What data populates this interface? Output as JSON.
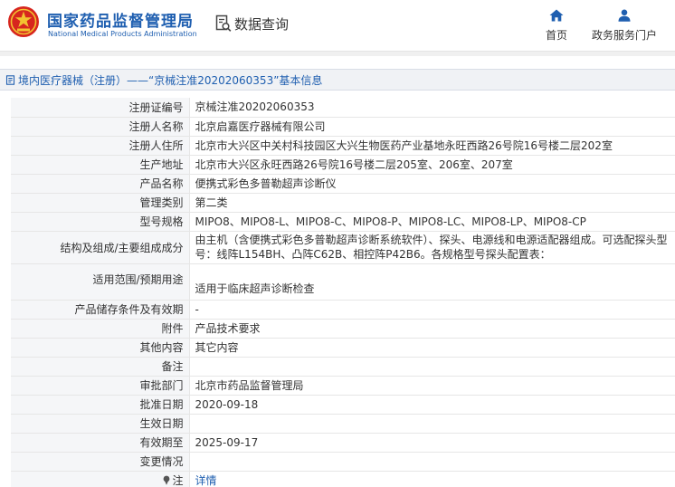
{
  "header": {
    "brand_cn": "国家药品监督管理局",
    "brand_en": "National Medical Products Administration",
    "query_label": "数据查询",
    "nav": [
      {
        "label": "首页",
        "icon": "home-icon"
      },
      {
        "label": "政务服务门户",
        "icon": "user-icon"
      }
    ]
  },
  "breadcrumb": {
    "text": "境内医疗器械（注册）——“京械注准20202060353”基本信息"
  },
  "rows": [
    {
      "label": "注册证编号",
      "value": "京械注准20202060353"
    },
    {
      "label": "注册人名称",
      "value": "北京启嘉医疗器械有限公司"
    },
    {
      "label": "注册人住所",
      "value": "北京市大兴区中关村科技园区大兴生物医药产业基地永旺西路26号院16号楼二层202室"
    },
    {
      "label": "生产地址",
      "value": "北京市大兴区永旺西路26号院16号楼二层205室、206室、207室"
    },
    {
      "label": "产品名称",
      "value": "便携式彩色多普勒超声诊断仪"
    },
    {
      "label": "管理类别",
      "value": "第二类"
    },
    {
      "label": "型号规格",
      "value": "MIPO8、MIPO8-L、MIPO8-C、MIPO8-P、MIPO8-LC、MIPO8-LP、MIPO8-CP"
    },
    {
      "label": "结构及组成/主要组成成分",
      "value": "由主机（含便携式彩色多普勒超声诊断系统软件）、探头、电源线和电源适配器组成。可选配探头型号：线阵L154BH、凸阵C62B、相控阵P42B6。各规格型号探头配置表："
    },
    {
      "label": "适用范围/预期用途",
      "value": "适用于临床超声诊断检查"
    },
    {
      "label": "产品储存条件及有效期",
      "value": "-"
    },
    {
      "label": "附件",
      "value": "产品技术要求"
    },
    {
      "label": "其他内容",
      "value": "其它内容"
    },
    {
      "label": "备注",
      "value": ""
    },
    {
      "label": "审批部门",
      "value": "北京市药品监督管理局"
    },
    {
      "label": "批准日期",
      "value": "2020-09-18"
    },
    {
      "label": "生效日期",
      "value": ""
    },
    {
      "label": "有效期至",
      "value": "2025-09-17"
    },
    {
      "label": "变更情况",
      "value": ""
    },
    {
      "label": "注",
      "value": "详情",
      "icon": "pin-icon"
    }
  ],
  "colors": {
    "brand": "#1f5fb0",
    "logo_red": "#d7261e",
    "logo_gold": "#f2c230"
  }
}
